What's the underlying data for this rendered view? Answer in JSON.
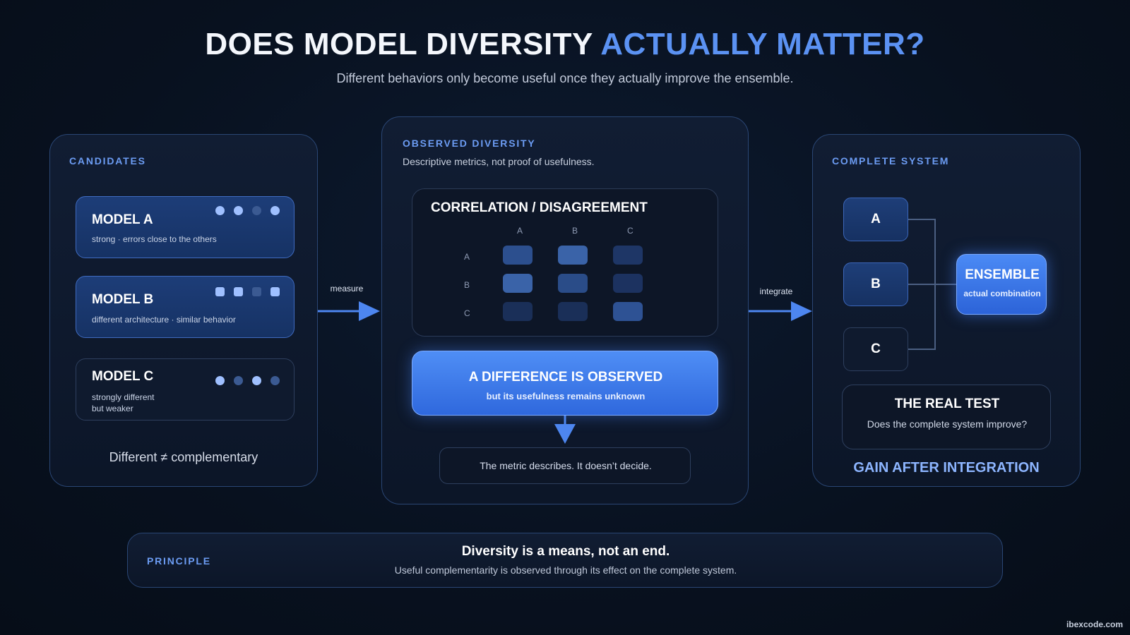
{
  "header": {
    "title_main": "DOES MODEL DIVERSITY ",
    "title_accent": "ACTUALLY MATTER?",
    "subtitle": "Different behaviors only become useful once they actually improve the ensemble."
  },
  "candidates": {
    "label": "CANDIDATES",
    "models": [
      {
        "name": "MODEL A",
        "desc": "strong · errors close to the others",
        "pips": [
          1,
          1,
          0,
          1
        ],
        "shape": "circle"
      },
      {
        "name": "MODEL B",
        "desc": "different architecture · similar behavior",
        "pips": [
          1,
          1,
          0,
          1
        ],
        "shape": "square"
      },
      {
        "name": "MODEL C",
        "desc_line1": "strongly different",
        "desc_line2": "but weaker",
        "pips": [
          1,
          0,
          1,
          0
        ],
        "shape": "circle"
      }
    ],
    "footer": "Different ≠ complementary"
  },
  "arrows": {
    "measure": "measure",
    "integrate": "integrate"
  },
  "observed": {
    "label": "OBSERVED DIVERSITY",
    "desc": "Descriptive metrics, not proof of usefulness.",
    "matrix": {
      "title": "CORRELATION / DISAGREEMENT",
      "cols": [
        "A",
        "B",
        "C"
      ],
      "rows": [
        "A",
        "B",
        "C"
      ],
      "cells": [
        [
          "#2c4f8e",
          "#3a63a8",
          "#1e3666"
        ],
        [
          "#3a63a8",
          "#2a4c88",
          "#1c3260"
        ],
        [
          "#1a2f58",
          "#1a2f58",
          "#2e5294"
        ]
      ]
    },
    "highlight_title": "A DIFFERENCE IS OBSERVED",
    "highlight_sub": "but its usefulness remains unknown",
    "note": "The metric describes. It doesn’t decide."
  },
  "system": {
    "label": "COMPLETE SYSTEM",
    "nodes": [
      "A",
      "B",
      "C"
    ],
    "ensemble_title": "ENSEMBLE",
    "ensemble_sub": "actual combination",
    "test_title": "THE REAL TEST",
    "test_desc": "Does the complete system improve?",
    "gain": "GAIN AFTER INTEGRATION"
  },
  "principle": {
    "label": "PRINCIPLE",
    "title": "Diversity is a means, not an end.",
    "desc": "Useful complementarity is observed through its effect on the complete system."
  },
  "watermark": "ibexcode.com",
  "colors": {
    "accent": "#5b92f3",
    "panel_border": "#2a4674",
    "highlight": "#3d7bf0"
  }
}
